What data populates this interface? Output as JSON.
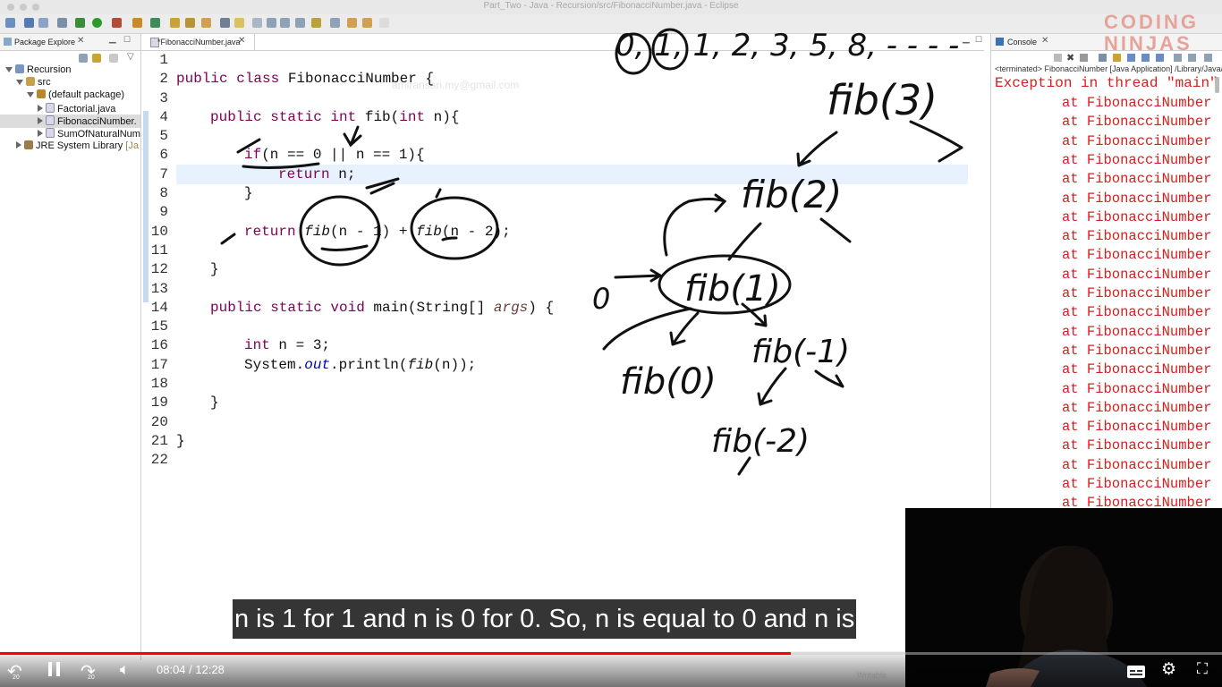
{
  "window": {
    "title": "Part_Two - Java - Recursion/src/FibonacciNumber.java - Eclipse"
  },
  "package_explorer": {
    "tab_label": "Package Explore",
    "tree": [
      {
        "label": "Recursion",
        "level": 0
      },
      {
        "label": "src",
        "level": 1
      },
      {
        "label": "(default package)",
        "level": 2
      },
      {
        "label": "Factorial.java",
        "level": 3
      },
      {
        "label": "FibonacciNumber.",
        "level": 3
      },
      {
        "label": "SumOfNaturalNum",
        "level": 3
      },
      {
        "label": "JRE System Library",
        "suffix": "[Ja",
        "level": 1
      }
    ]
  },
  "editor": {
    "tab_label": "*FibonacciNumber.java",
    "watermark": "amiransari.my@gmail.com",
    "line_numbers": [
      "1",
      "2",
      "3",
      "4",
      "5",
      "6",
      "7",
      "8",
      "9",
      "10",
      "11",
      "12",
      "13",
      "14",
      "15",
      "16",
      "17",
      "18",
      "19",
      "20",
      "21",
      "22"
    ],
    "code": {
      "l2": {
        "kw": "public class",
        "rest": " FibonacciNumber {"
      },
      "l4": {
        "kw": "public static int",
        "rest": " fib(",
        "kw2": "int",
        "rest2": " n){"
      },
      "l6": {
        "kw": "if",
        "rest": "(n == 0 || n == 1){"
      },
      "l7": {
        "kw": "return",
        "rest": " n;"
      },
      "l8": {
        "rest": "}"
      },
      "l10": {
        "kw": "return",
        "sp": " ",
        "call1": "fib",
        "arg1": "(n - 1)",
        "plus": " + ",
        "call2": "fib",
        "arg2": "(n - 2);"
      },
      "l12": {
        "rest": "}"
      },
      "l14": {
        "kw": "public static void",
        "rest": " main(String[] ",
        "arg": "args",
        "rest2": ") {"
      },
      "l16": {
        "kw": "int",
        "rest": " n = 3;"
      },
      "l17": {
        "pre": "System.",
        "fld": "out",
        "mid": ".println(",
        "call": "fib",
        "post": "(n));"
      },
      "l19": {
        "rest": "}"
      },
      "l21": {
        "rest": "}"
      }
    }
  },
  "annotations": {
    "sequence": "0, 1, 1, 2, 3, 5, 8, - - - -",
    "nodes": [
      "fib(3)",
      "fib(2)",
      "fib(1)",
      "fib(0)",
      "fib(-1)",
      "fib(-2)"
    ],
    "zero": "0"
  },
  "console": {
    "tab_label": "Console",
    "terminated": "<terminated> FibonacciNumber [Java Application] /Library/Java/Jav",
    "header": "Exception in thread \"main\"",
    "line_text": "at FibonacciNumber",
    "lines": [
      "at FibonacciNumber",
      "at FibonacciNumber",
      "at FibonacciNumber",
      "at FibonacciNumber",
      "at FibonacciNumber",
      "at FibonacciNumber",
      "at FibonacciNumber",
      "at FibonacciNumber",
      "at FibonacciNumber",
      "at FibonacciNumber",
      "at FibonacciNumber",
      "at FibonacciNumber",
      "at FibonacciNumber",
      "at FibonacciNumber",
      "at FibonacciNumber",
      "at FibonacciNumber",
      "at FibonacciNumber",
      "at FibonacciNumber",
      "at FibonacciNumber",
      "at FibonacciNumber",
      "at FibonacciNumber",
      "at FibonacciNumber"
    ]
  },
  "logo": {
    "top": "CODING",
    "bottom": "NINJAS"
  },
  "video": {
    "subtitle": "n is 1 for 1 and n is 0 for 0. So, n is equal to 0 and n is",
    "time": "08:04 / 12:28",
    "progress": 0.647,
    "skip_back": "20",
    "skip_forward": "20",
    "status": "Writable"
  },
  "colors": {
    "keyword": "#7f0055",
    "console_error": "#d81e1e",
    "progress": "#ff0000",
    "highlight_line": "#e8f2fe"
  }
}
